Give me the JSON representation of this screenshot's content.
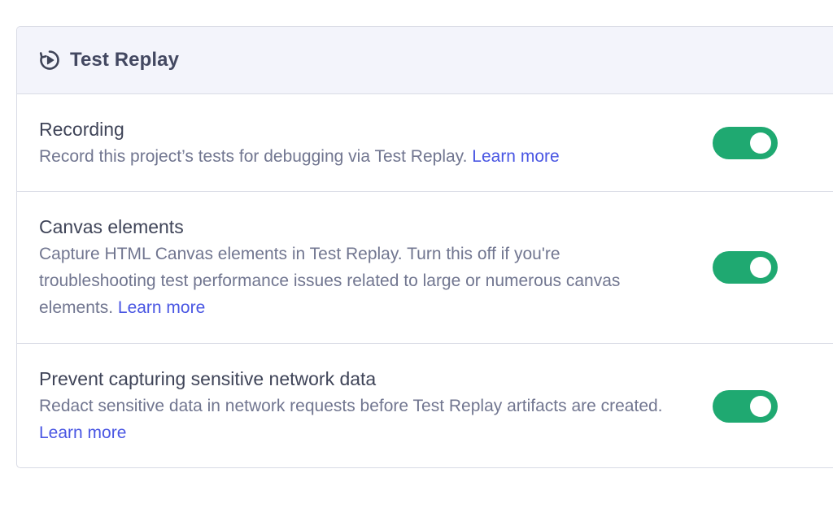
{
  "panel": {
    "title": "Test Replay",
    "icon": "test-replay-icon"
  },
  "settings": [
    {
      "title": "Recording",
      "description": "Record this project’s tests for debugging via Test Replay. ",
      "link_label": "Learn more",
      "enabled": true
    },
    {
      "title": "Canvas elements",
      "description": "Capture HTML Canvas elements in Test Replay. Turn this off if you're troubleshooting test performance issues related to large or numerous canvas elements. ",
      "link_label": "Learn more",
      "enabled": true
    },
    {
      "title": "Prevent capturing sensitive network data",
      "description": "Redact sensitive data in network requests before Test Replay artifacts are created. ",
      "link_label": "Learn more",
      "enabled": true
    }
  ],
  "colors": {
    "toggle_on": "#1fa971",
    "link": "#4956e3",
    "header_bg": "#f3f4fb",
    "border": "#d9dbe5"
  }
}
